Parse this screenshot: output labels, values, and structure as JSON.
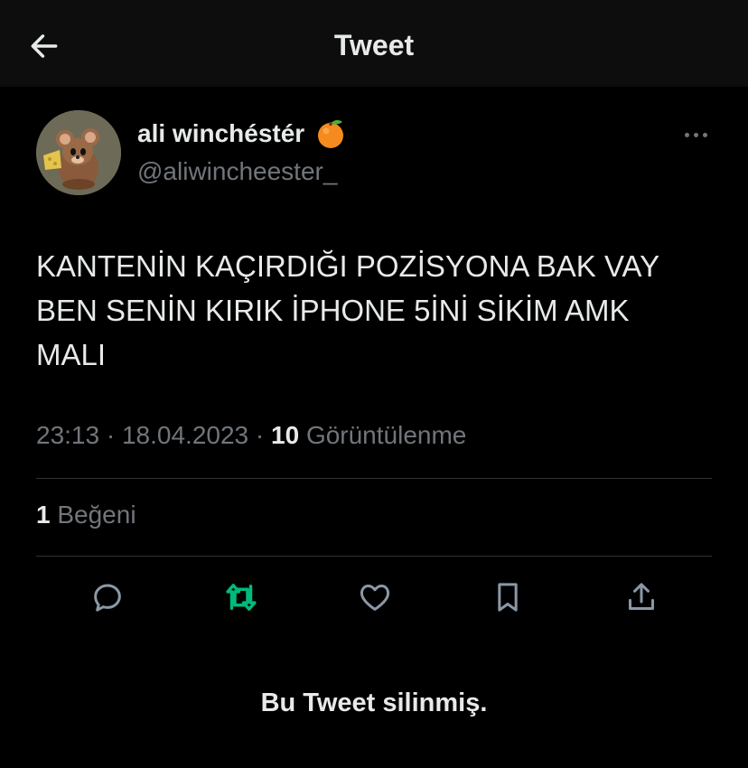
{
  "header": {
    "title": "Tweet",
    "back_icon": "arrow-left-icon"
  },
  "author": {
    "display_name": "ali winchéstér",
    "emoji": "🍊",
    "handle": "@aliwincheester_"
  },
  "tweet": {
    "lines": [
      "KANTENİN KAÇIRDIĞI POZİSYONA BAK VAY",
      "BEN SENİN KIRIK İPHONE 5İNİ SİKİM AMK",
      "MALI"
    ],
    "time": "23:13",
    "date": "18.04.2023",
    "separator": "·",
    "views_count": "10",
    "views_label": "Görüntülenme",
    "likes_count": "1",
    "likes_label": "Beğeni"
  },
  "actions": {
    "icons": [
      "reply-icon",
      "retweet-icon",
      "like-icon",
      "bookmark-icon",
      "share-icon"
    ],
    "retweet_color": "#00ba7c"
  },
  "footer": {
    "notice": "Bu Tweet silinmiş."
  }
}
